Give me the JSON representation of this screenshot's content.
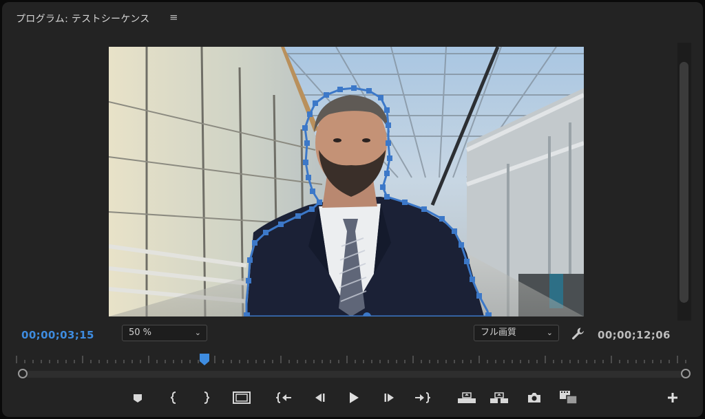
{
  "panel": {
    "title": "プログラム: テストシーケンス",
    "menu_glyph": "≡"
  },
  "timecode": {
    "current": "00;00;03;15",
    "duration": "00;00;12;06"
  },
  "zoom": {
    "value": "50 %",
    "chevron": "⌄"
  },
  "quality": {
    "value": "フル画質",
    "chevron": "⌄"
  },
  "colors": {
    "accent_blue": "#3e8ce0",
    "mask_blue": "#3c78c8",
    "panel_bg": "#232323"
  },
  "playhead_progress": 0.28,
  "icons": {
    "wrench": "wrench-icon",
    "add_marker": "marker-icon",
    "mark_in": "mark-in-icon",
    "mark_out": "mark-out-icon",
    "safe_margins": "safe-margins-icon",
    "go_to_in": "go-to-in-icon",
    "step_back": "step-back-icon",
    "play": "play-icon",
    "step_forward": "step-forward-icon",
    "go_to_out": "go-to-out-icon",
    "lift": "lift-icon",
    "extract": "extract-icon",
    "export_frame": "camera-icon",
    "comparison_view": "comparison-view-icon",
    "button_editor": "plus-icon"
  }
}
